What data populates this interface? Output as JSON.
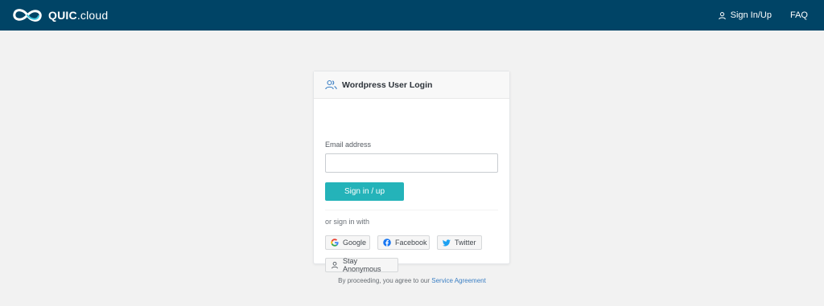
{
  "header": {
    "brand_name": "QUIC",
    "brand_suffix": ".cloud",
    "logo_icon": "quic-cloud-infinity-logo",
    "nav": [
      {
        "label": "Sign In/Up",
        "icon": "user-icon"
      },
      {
        "label": "FAQ"
      }
    ],
    "background_color": "#004466"
  },
  "login_card": {
    "title": "Wordpress User Login",
    "title_icon": "users-icon",
    "email_label": "Email address",
    "email_value": "",
    "email_placeholder": "",
    "submit_label": "Sign in / up",
    "submit_color": "#24b3b9",
    "alt_label": "or sign in with",
    "social": [
      {
        "label": "Google",
        "icon": "google-icon"
      },
      {
        "label": "Facebook",
        "icon": "facebook-icon"
      },
      {
        "label": "Twitter",
        "icon": "twitter-icon"
      },
      {
        "label": "Stay Anonymous",
        "icon": "user-icon"
      }
    ]
  },
  "footer": {
    "text": "By proceeding, you agree to our",
    "link_label": "Service Agreement"
  }
}
